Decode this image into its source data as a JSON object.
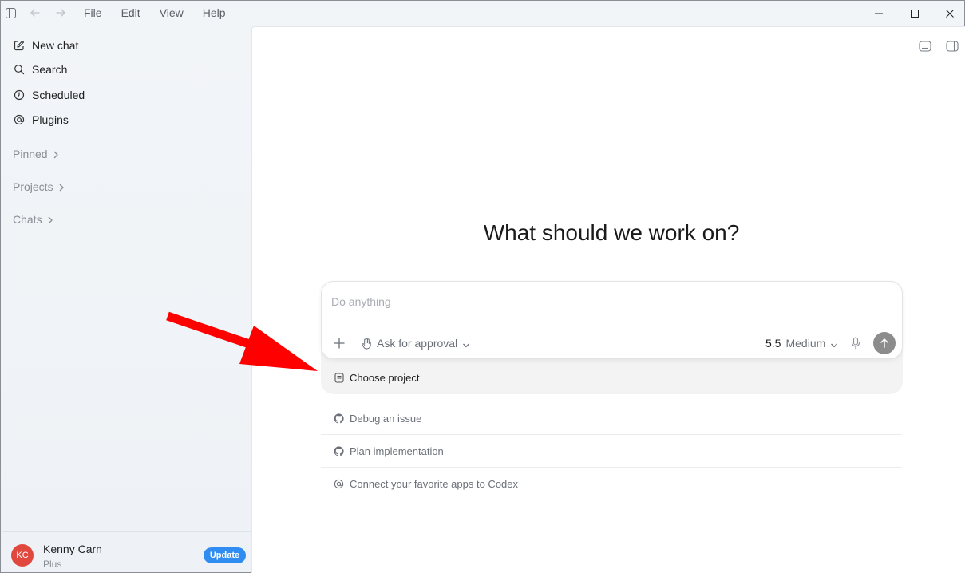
{
  "menu": {
    "file": "File",
    "edit": "Edit",
    "view": "View",
    "help": "Help"
  },
  "sidebar": {
    "items": [
      {
        "label": "New chat",
        "icon": "edit-icon"
      },
      {
        "label": "Search",
        "icon": "search-icon"
      },
      {
        "label": "Scheduled",
        "icon": "clock-icon"
      },
      {
        "label": "Plugins",
        "icon": "at-icon"
      }
    ],
    "sections": [
      {
        "label": "Pinned"
      },
      {
        "label": "Projects"
      },
      {
        "label": "Chats"
      }
    ]
  },
  "user": {
    "initials": "KC",
    "name": "Kenny Carn",
    "plan": "Plus",
    "update_label": "Update"
  },
  "main": {
    "heading": "What should we work on?",
    "composer": {
      "placeholder": "Do anything",
      "approval_label": "Ask for approval",
      "model_version": "5.5",
      "model_effort": "Medium"
    },
    "choose_project_label": "Choose project",
    "suggestions": [
      {
        "label": "Debug an issue",
        "icon": "github-icon"
      },
      {
        "label": "Plan implementation",
        "icon": "github-icon"
      },
      {
        "label": "Connect your favorite apps to Codex",
        "icon": "at-icon"
      }
    ]
  },
  "colors": {
    "avatar": "#e0483e",
    "update_button": "#2f8cf0",
    "send_button": "#8c8c8c",
    "annotation_arrow": "#ff0000"
  }
}
